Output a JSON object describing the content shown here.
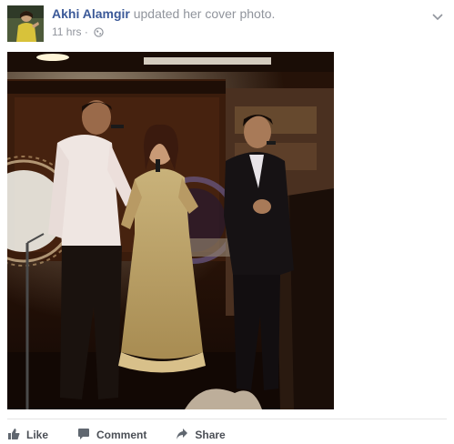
{
  "post": {
    "author": "Akhi Alamgir",
    "action_text": "updated her cover photo.",
    "timestamp": "11 hrs",
    "separator": "·",
    "privacy_icon": "globe-icon",
    "menu_icon": "chevron-down-icon"
  },
  "actions": [
    {
      "label": "Like",
      "icon": "thumbs-up-icon"
    },
    {
      "label": "Comment",
      "icon": "comment-icon"
    },
    {
      "label": "Share",
      "icon": "share-icon"
    }
  ],
  "colors": {
    "link": "#3b5998",
    "meta": "#90949c",
    "action_text": "#4b4f56"
  }
}
